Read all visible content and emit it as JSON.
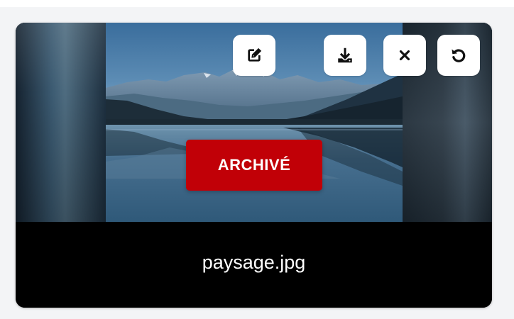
{
  "card": {
    "status_badge": "ARCHIVÉ",
    "file_name": "paysage.jpg",
    "actions": {
      "edit": {
        "icon": "edit-icon"
      },
      "download": {
        "icon": "download-icon"
      },
      "close": {
        "icon": "close-icon"
      },
      "restore": {
        "icon": "restore-icon"
      }
    },
    "image": "mountain lake landscape"
  },
  "colors": {
    "badge": "#c10007",
    "caption_background": "#000000",
    "caption_text": "#ffffff",
    "button_background": "#ffffff",
    "icon": "#111111",
    "page_background": "#f3f4f6"
  }
}
